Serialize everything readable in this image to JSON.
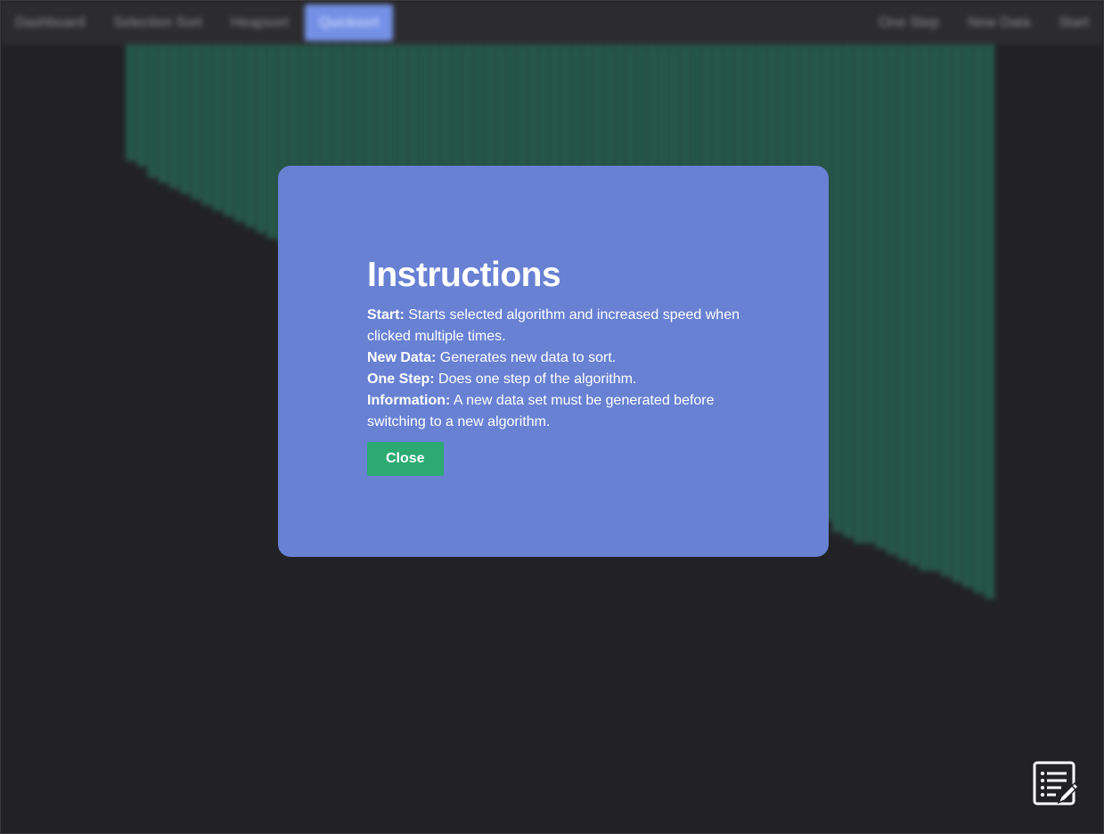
{
  "nav": {
    "left": [
      "Dashboard",
      "Selection Sort",
      "Heapsort",
      "Quicksort"
    ],
    "right": [
      "One Step",
      "New Data",
      "Start"
    ]
  },
  "chart_data": {
    "type": "bar",
    "bar_count": 80,
    "color": "#27574a",
    "values_desc": [
      100,
      99,
      98,
      97,
      96,
      95,
      95,
      94,
      93,
      92,
      91,
      90,
      90,
      89,
      88,
      86,
      85,
      84,
      83,
      81,
      80,
      79,
      78,
      77,
      76,
      76,
      75,
      74,
      73,
      72,
      71,
      70,
      69,
      68,
      67,
      66,
      65,
      64,
      63,
      62,
      61,
      60,
      59,
      58,
      57,
      56,
      55,
      54,
      53,
      52,
      51,
      50,
      49,
      48,
      47,
      46,
      45,
      44,
      43,
      42,
      41,
      40,
      39,
      38,
      37,
      36,
      35,
      34,
      33,
      32,
      31,
      30,
      29,
      28,
      27,
      26,
      25,
      24,
      22,
      21
    ]
  },
  "modal": {
    "title": "Instructions",
    "start_label": "Start:",
    "start_text": " Starts selected algorithm and increased speed when clicked multiple times.",
    "newdata_label": "New Data:",
    "newdata_text": " Generates new data to sort.",
    "onestep_label": "One Step:",
    "onestep_text": " Does one step of the algorithm.",
    "info_label": "Information:",
    "info_text": " A new data set must be generated before switching to a new algorithm.",
    "close_label": "Close"
  },
  "icons": {
    "notes": "notes-edit-icon"
  }
}
